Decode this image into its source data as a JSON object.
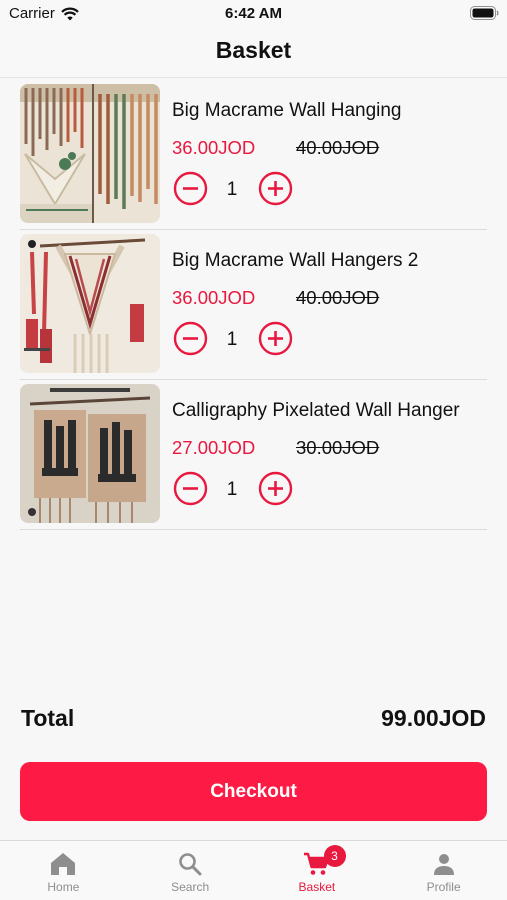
{
  "status_bar": {
    "carrier": "Carrier",
    "time": "6:42 AM"
  },
  "header": {
    "title": "Basket"
  },
  "items": [
    {
      "name": "Big Macrame Wall Hanging",
      "price": "36.00JOD",
      "old_price": "40.00JOD",
      "quantity": "1"
    },
    {
      "name": "Big Macrame Wall Hangers 2",
      "price": "36.00JOD",
      "old_price": "40.00JOD",
      "quantity": "1"
    },
    {
      "name": "Calligraphy Pixelated Wall Hanger",
      "price": "27.00JOD",
      "old_price": "30.00JOD",
      "quantity": "1"
    }
  ],
  "total": {
    "label": "Total",
    "value": "99.00JOD"
  },
  "checkout_label": "Checkout",
  "tabs": [
    {
      "label": "Home",
      "icon": "home-icon"
    },
    {
      "label": "Search",
      "icon": "search-icon"
    },
    {
      "label": "Basket",
      "icon": "cart-icon",
      "badge": "3",
      "active": true
    },
    {
      "label": "Profile",
      "icon": "profile-icon"
    }
  ],
  "colors": {
    "accent": "#fd1a45",
    "price": "#e8183f",
    "inactive_tab": "#8e8e8e"
  }
}
